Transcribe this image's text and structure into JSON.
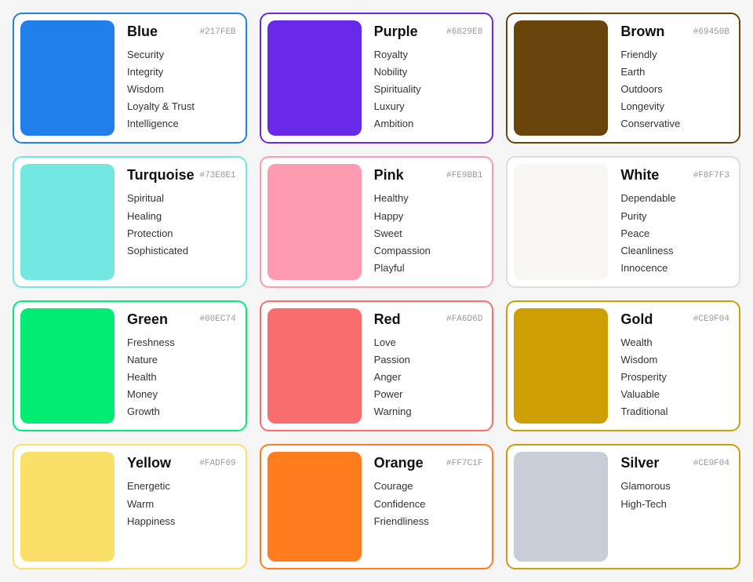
{
  "colors": [
    {
      "id": "blue",
      "name": "Blue",
      "hex": "#217FEB",
      "swatch": "#217FEB",
      "borderClass": "card-blue",
      "traits": [
        "Security",
        "Integrity",
        "Wisdom",
        "Loyalty & Trust",
        "Intelligence"
      ]
    },
    {
      "id": "purple",
      "name": "Purple",
      "hex": "#6829E8",
      "swatch": "#6829E8",
      "borderClass": "card-purple",
      "traits": [
        "Royalty",
        "Nobility",
        "Spirituality",
        "Luxury",
        "Ambition"
      ]
    },
    {
      "id": "brown",
      "name": "Brown",
      "hex": "#69450B",
      "swatch": "#69450B",
      "borderClass": "card-brown",
      "traits": [
        "Friendly",
        "Earth",
        "Outdoors",
        "Longevity",
        "Conservative"
      ]
    },
    {
      "id": "turquoise",
      "name": "Turquoise",
      "hex": "#73E8E1",
      "swatch": "#73E8E1",
      "borderClass": "card-turquoise",
      "traits": [
        "Spiritual",
        "Healing",
        "Protection",
        "Sophisticated"
      ]
    },
    {
      "id": "pink",
      "name": "Pink",
      "hex": "#FE9BB1",
      "swatch": "#FE9BB1",
      "borderClass": "card-pink",
      "traits": [
        "Healthy",
        "Happy",
        "Sweet",
        "Compassion",
        "Playful"
      ]
    },
    {
      "id": "white",
      "name": "White",
      "hex": "#F8F7F3",
      "swatch": "#F8F7F3",
      "borderClass": "card-white",
      "traits": [
        "Dependable",
        "Purity",
        "Peace",
        "Cleanliness",
        "Innocence"
      ]
    },
    {
      "id": "green",
      "name": "Green",
      "hex": "#00EC74",
      "swatch": "#00EC74",
      "borderClass": "card-green",
      "traits": [
        "Freshness",
        "Nature",
        "Health",
        "Money",
        "Growth"
      ]
    },
    {
      "id": "red",
      "name": "Red",
      "hex": "#FA6D6D",
      "swatch": "#FA6D6D",
      "borderClass": "card-red",
      "traits": [
        "Love",
        "Passion",
        "Anger",
        "Power",
        "Warning"
      ]
    },
    {
      "id": "gold",
      "name": "Gold",
      "hex": "#CE9F04",
      "swatch": "#CE9F04",
      "borderClass": "card-gold",
      "traits": [
        "Wealth",
        "Wisdom",
        "Prosperity",
        "Valuable",
        "Traditional"
      ]
    },
    {
      "id": "yellow",
      "name": "Yellow",
      "hex": "#FADF69",
      "swatch": "#FADF69",
      "borderClass": "card-yellow",
      "traits": [
        "Energetic",
        "Warm",
        "Happiness"
      ]
    },
    {
      "id": "orange",
      "name": "Orange",
      "hex": "#FF7C1F",
      "swatch": "#FF7C1F",
      "borderClass": "card-orange",
      "traits": [
        "Courage",
        "Confidence",
        "Friendliness"
      ]
    },
    {
      "id": "silver",
      "name": "Silver",
      "hex": "#CE9F04",
      "swatch": "#C8CDD6",
      "borderClass": "card-silver",
      "traits": [
        "Glamorous",
        "High-Tech"
      ]
    }
  ]
}
